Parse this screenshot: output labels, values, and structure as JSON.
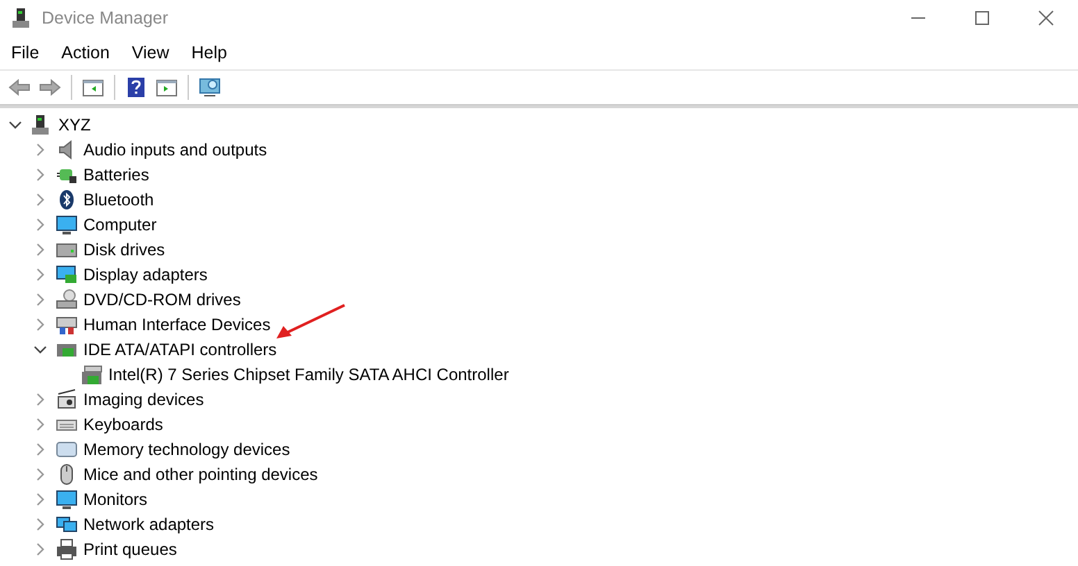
{
  "window": {
    "title": "Device Manager"
  },
  "menu": [
    "File",
    "Action",
    "View",
    "Help"
  ],
  "tree": [
    {
      "label": "XYZ",
      "expanded": true,
      "children": [
        {
          "label": "Audio inputs and outputs",
          "expanded": false
        },
        {
          "label": "Batteries",
          "expanded": false
        },
        {
          "label": "Bluetooth",
          "expanded": false
        },
        {
          "label": "Computer",
          "expanded": false
        },
        {
          "label": "Disk drives",
          "expanded": false
        },
        {
          "label": "Display adapters",
          "expanded": false
        },
        {
          "label": "DVD/CD-ROM drives",
          "expanded": false
        },
        {
          "label": "Human Interface Devices",
          "expanded": false
        },
        {
          "label": "IDE ATA/ATAPI controllers",
          "expanded": true,
          "children": [
            {
              "label": "Intel(R) 7 Series Chipset Family SATA AHCI Controller"
            }
          ]
        },
        {
          "label": "Imaging devices",
          "expanded": false
        },
        {
          "label": "Keyboards",
          "expanded": false
        },
        {
          "label": "Memory technology devices",
          "expanded": false
        },
        {
          "label": "Mice and other pointing devices",
          "expanded": false
        },
        {
          "label": "Monitors",
          "expanded": false
        },
        {
          "label": "Network adapters",
          "expanded": false
        },
        {
          "label": "Print queues",
          "expanded": false
        }
      ]
    }
  ]
}
